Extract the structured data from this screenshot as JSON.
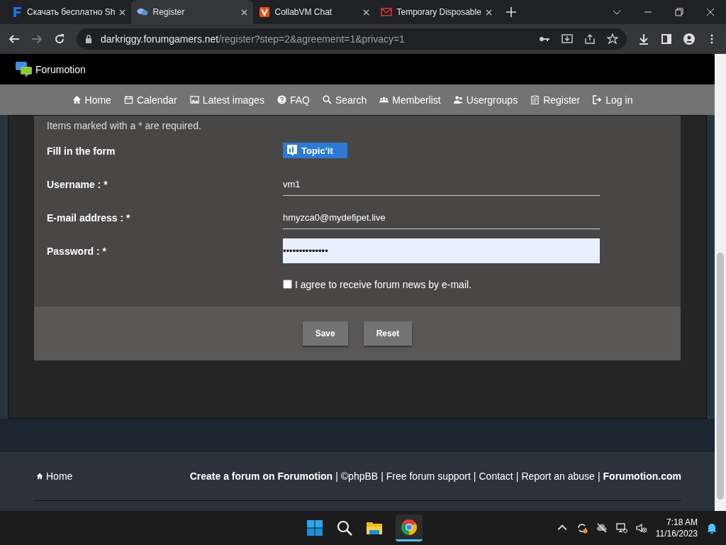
{
  "browser": {
    "tabs": [
      {
        "title": "Скачать бесплатно Sh",
        "selected": false,
        "kind": "f"
      },
      {
        "title": "Register",
        "selected": true,
        "kind": "chat"
      },
      {
        "title": "CollabVM Chat",
        "selected": false,
        "kind": "v"
      },
      {
        "title": "Temporary Disposable",
        "selected": false,
        "kind": "mail"
      }
    ],
    "url_host": "darkriggy.forumgamers.net",
    "url_path": "/register?step=2&agreement=1&privacy=1"
  },
  "site": {
    "brand": "Forumotion",
    "nav": [
      {
        "label": "Home",
        "kind": "home"
      },
      {
        "label": "Calendar",
        "kind": "calendar"
      },
      {
        "label": "Latest images",
        "kind": "image"
      },
      {
        "label": "FAQ",
        "kind": "faq"
      },
      {
        "label": "Search",
        "kind": "search"
      },
      {
        "label": "Memberlist",
        "kind": "members"
      },
      {
        "label": "Usergroups",
        "kind": "groups"
      },
      {
        "label": "Register",
        "kind": "register"
      },
      {
        "label": "Log in",
        "kind": "login"
      }
    ]
  },
  "form": {
    "note": "Items marked with a * are required.",
    "fill_label": "Fill in the form",
    "topicit": "Topic'it",
    "fields": [
      {
        "label": "Username : *",
        "value": "vm1",
        "kind": "text"
      },
      {
        "label": "E-mail address : *",
        "value": "hmyzca0@mydefipet.live",
        "kind": "text"
      },
      {
        "label": "Password : *",
        "value": "••••••••••••••",
        "kind": "password"
      }
    ],
    "newsletter": {
      "label": "I agree to receive forum news by e-mail.",
      "checked": false
    },
    "buttons": [
      "Save",
      "Reset"
    ]
  },
  "footer": {
    "home": "Home",
    "links": [
      {
        "text": "Create a forum on Forumotion",
        "bold": true
      },
      {
        "text": "©phpBB",
        "bold": false
      },
      {
        "text": "Free forum support",
        "bold": false
      },
      {
        "text": "Contact",
        "bold": false
      },
      {
        "text": "Report an abuse",
        "bold": false
      },
      {
        "text": "Forumotion.com",
        "bold": true
      }
    ],
    "separators": [
      "|",
      "|",
      "|",
      "|",
      "|"
    ]
  },
  "taskbar": {
    "time": "7:18 AM",
    "date": "11/16/2023"
  }
}
